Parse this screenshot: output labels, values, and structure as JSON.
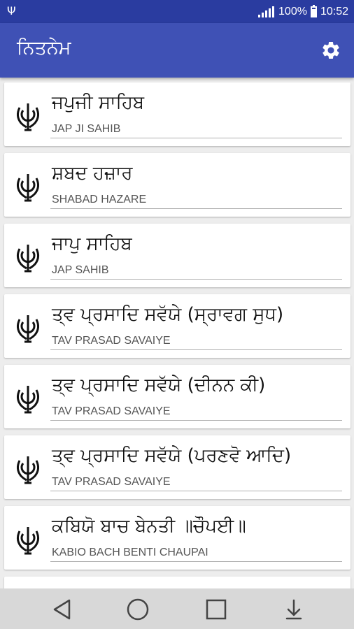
{
  "status": {
    "battery_percent": "100%",
    "time": "10:52"
  },
  "app": {
    "title": "ਨਿਤਨੇਮ"
  },
  "items": [
    {
      "title": "ਜਪੁਜੀ ਸਾਹਿਬ",
      "subtitle": "JAP JI SAHIB"
    },
    {
      "title": "ਸ਼ਬਦ ਹਜ਼ਾਰ",
      "subtitle": "SHABAD HAZARE"
    },
    {
      "title": "ਜਾਪੁ ਸਾਹਿਬ",
      "subtitle": "JAP SAHIB"
    },
    {
      "title": "ਤ੍ਵ ਪ੍ਰਸਾਦਿ ਸਵੱਯੇ (ਸ੍ਰਾਵਗ ਸੁਧ)",
      "subtitle": "TAV PRASAD SAVAIYE"
    },
    {
      "title": "ਤ੍ਵ ਪ੍ਰਸਾਦਿ ਸਵੱਯੇ (ਦੀਨਨ ਕੀ)",
      "subtitle": "TAV PRASAD SAVAIYE"
    },
    {
      "title": "ਤ੍ਵ ਪ੍ਰਸਾਦਿ ਸਵੱਯੇ (ਪਰਣਵੋ ਆਦਿ)",
      "subtitle": "TAV PRASAD SAVAIYE"
    },
    {
      "title": "ਕਬਿਯੋ ਬਾਚ ਬੇਨਤੀ ॥ਚੌਪਈ॥",
      "subtitle": "KABIO BACH BENTI CHAUPAI"
    }
  ],
  "icons": {
    "item_icon": "khanda-icon",
    "settings": "gear-icon",
    "nav_back": "back-triangle-icon",
    "nav_home": "home-circle-icon",
    "nav_recents": "recents-square-icon",
    "nav_extra": "download-arrow-icon"
  },
  "colors": {
    "app_bar": "#3f51b5",
    "status_bar": "#2a3ca0",
    "background": "#ededed",
    "card": "#ffffff"
  }
}
